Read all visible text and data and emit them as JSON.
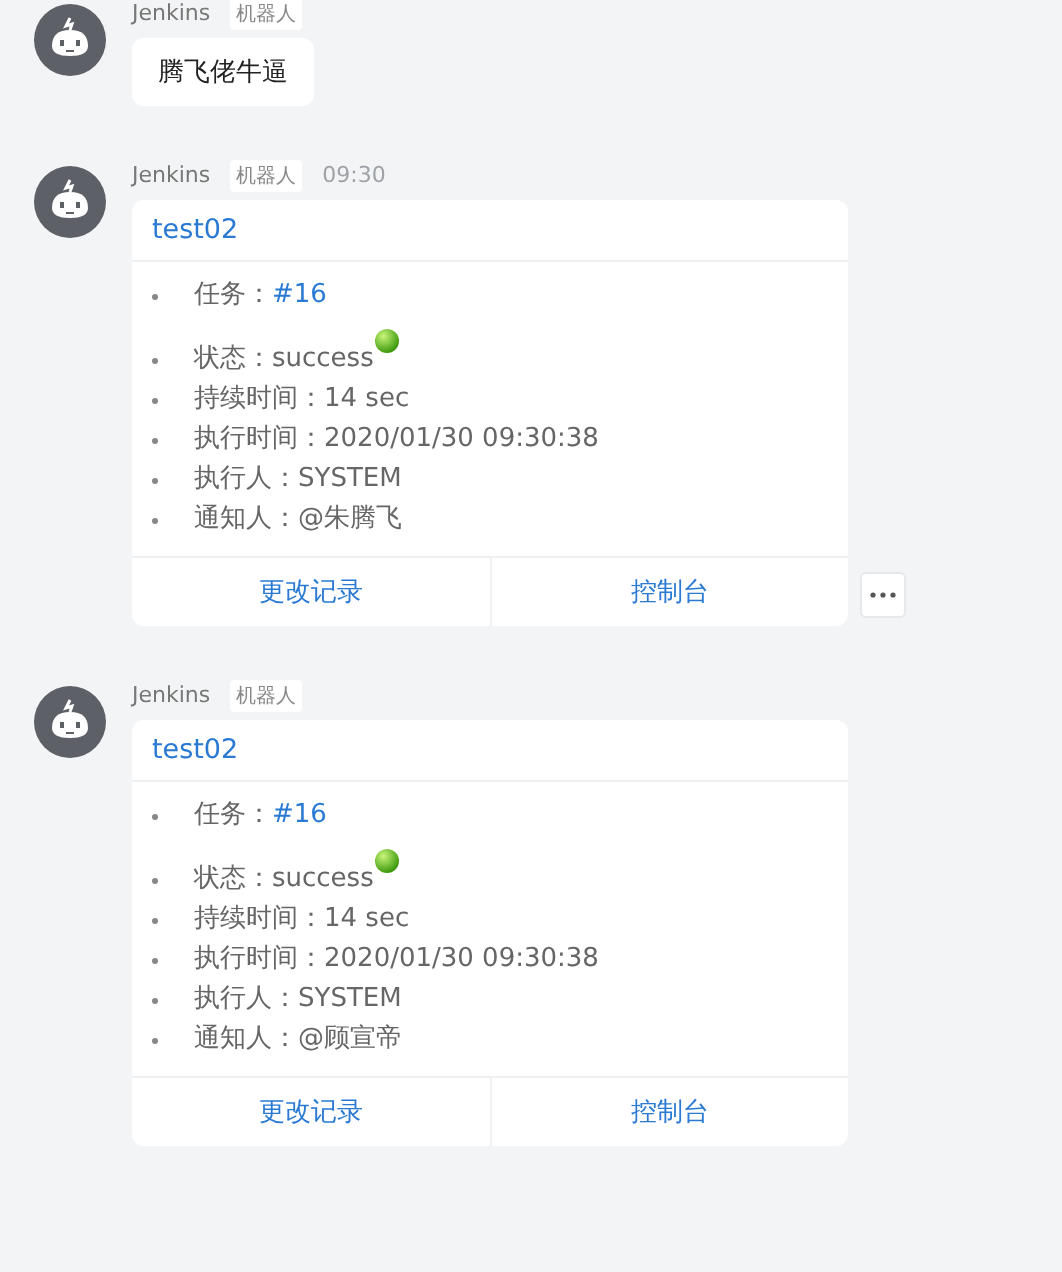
{
  "messages": [
    {
      "kind": "text",
      "sender": "Jenkins",
      "badge": "机器人",
      "text": "腾飞佬牛逼",
      "more_button": false
    },
    {
      "kind": "card",
      "sender": "Jenkins",
      "badge": "机器人",
      "time": "09:30",
      "title": "test02",
      "more_button": true,
      "items": [
        {
          "kind": "link",
          "label": "任务：",
          "value": "#16"
        },
        {
          "kind": "status",
          "label": "状态：",
          "value": "success"
        },
        {
          "kind": "text",
          "label": "持续时间：",
          "value": "14 sec"
        },
        {
          "kind": "text",
          "label": "执行时间：",
          "value": "2020/01/30 09:30:38"
        },
        {
          "kind": "text",
          "label": "执行人：",
          "value": "SYSTEM"
        },
        {
          "kind": "text",
          "label": "通知人：",
          "value": "@朱腾飞"
        }
      ],
      "actions": [
        "更改记录",
        "控制台"
      ]
    },
    {
      "kind": "card",
      "sender": "Jenkins",
      "badge": "机器人",
      "title": "test02",
      "more_button": false,
      "items": [
        {
          "kind": "link",
          "label": "任务：",
          "value": "#16"
        },
        {
          "kind": "status",
          "label": "状态：",
          "value": "success"
        },
        {
          "kind": "text",
          "label": "持续时间：",
          "value": "14 sec"
        },
        {
          "kind": "text",
          "label": "执行时间：",
          "value": "2020/01/30 09:30:38"
        },
        {
          "kind": "text",
          "label": "执行人：",
          "value": "SYSTEM"
        },
        {
          "kind": "text",
          "label": "通知人：",
          "value": "@顾宣帝"
        }
      ],
      "actions": [
        "更改记录",
        "控制台"
      ]
    }
  ]
}
